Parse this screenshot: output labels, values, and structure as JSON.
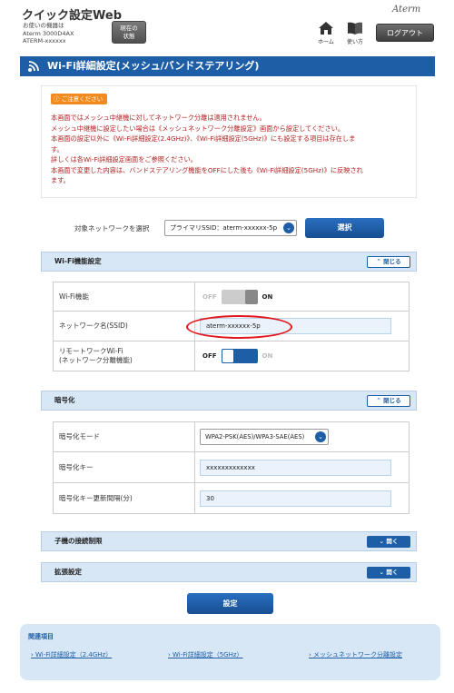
{
  "header": {
    "app_title": "クイック設定Web",
    "device_info_line1": "お使いの機器は",
    "device_info_line2": "Aterm 3000D4AX",
    "device_info_line3": "ATERM-xxxxxx",
    "status_btn_line1": "現在の",
    "status_btn_line2": "状態",
    "brand": "Aterm",
    "home_label": "ホーム",
    "manual_label": "使い方",
    "logout_label": "ログアウト"
  },
  "page_title": "Wi-Fi詳細設定(メッシュ/バンドステアリング)",
  "notice": {
    "badge": "ご注意ください",
    "lines": [
      "本画面ではメッシュ中継機に対してネットワーク分離は適用されません。",
      "メッシュ中継機に設定したい場合は《メッシュネットワーク分離設定》画面から設定してください。",
      "本画面の設定以外に《Wi-Fi詳細設定(2.4GHz)》、《Wi-Fi詳細設定(5GHz)》にも設定する項目は存在しま",
      "す。",
      "詳しくは各Wi-Fi詳細設定画面をご参照ください。",
      "本画面で変更した内容は、バンドステアリング機能をOFFにした後も《Wi-Fi詳細設定(5GHz)》に反映され",
      "ます。"
    ]
  },
  "network_select": {
    "label": "対象ネットワークを選択",
    "value": "プライマリSSID：aterm-xxxxxx-5p",
    "button": "選択"
  },
  "wifi_section": {
    "title": "Wi-Fi機能設定",
    "toggle": "閉じる",
    "wifi_label": "Wi-Fi機能",
    "wifi_off": "OFF",
    "wifi_on": "ON",
    "ssid_label": "ネットワーク名(SSID)",
    "ssid_value": "aterm-xxxxxx-5p",
    "remote_label_line1": "リモートワークWi-Fi",
    "remote_label_line2": "(ネットワーク分離機能)",
    "remote_off": "OFF",
    "remote_on": "ON"
  },
  "encryption_section": {
    "title": "暗号化",
    "toggle": "閉じる",
    "mode_label": "暗号化モード",
    "mode_value": "WPA2-PSK(AES)/WPA3-SAE(AES)",
    "key_label": "暗号化キー",
    "key_value": "xxxxxxxxxxxxx",
    "interval_label": "暗号化キー更新間隔(分)",
    "interval_value": "30"
  },
  "child_section": {
    "title": "子機の接続制限",
    "toggle": "開く"
  },
  "advanced_section": {
    "title": "拡張設定",
    "toggle": "開く"
  },
  "apply_button": "設定",
  "related": {
    "title": "関連項目",
    "links": [
      "Wi-Fi詳細設定（2.4GHz）",
      "Wi-Fi詳細設定（5GHz）",
      "メッシュネットワーク分離設定"
    ]
  },
  "colors": {
    "primary": "#1d5ea6",
    "section_bg": "#d7e7f6",
    "notice_text": "#b22222",
    "highlight_ellipse": "#e0161c"
  }
}
